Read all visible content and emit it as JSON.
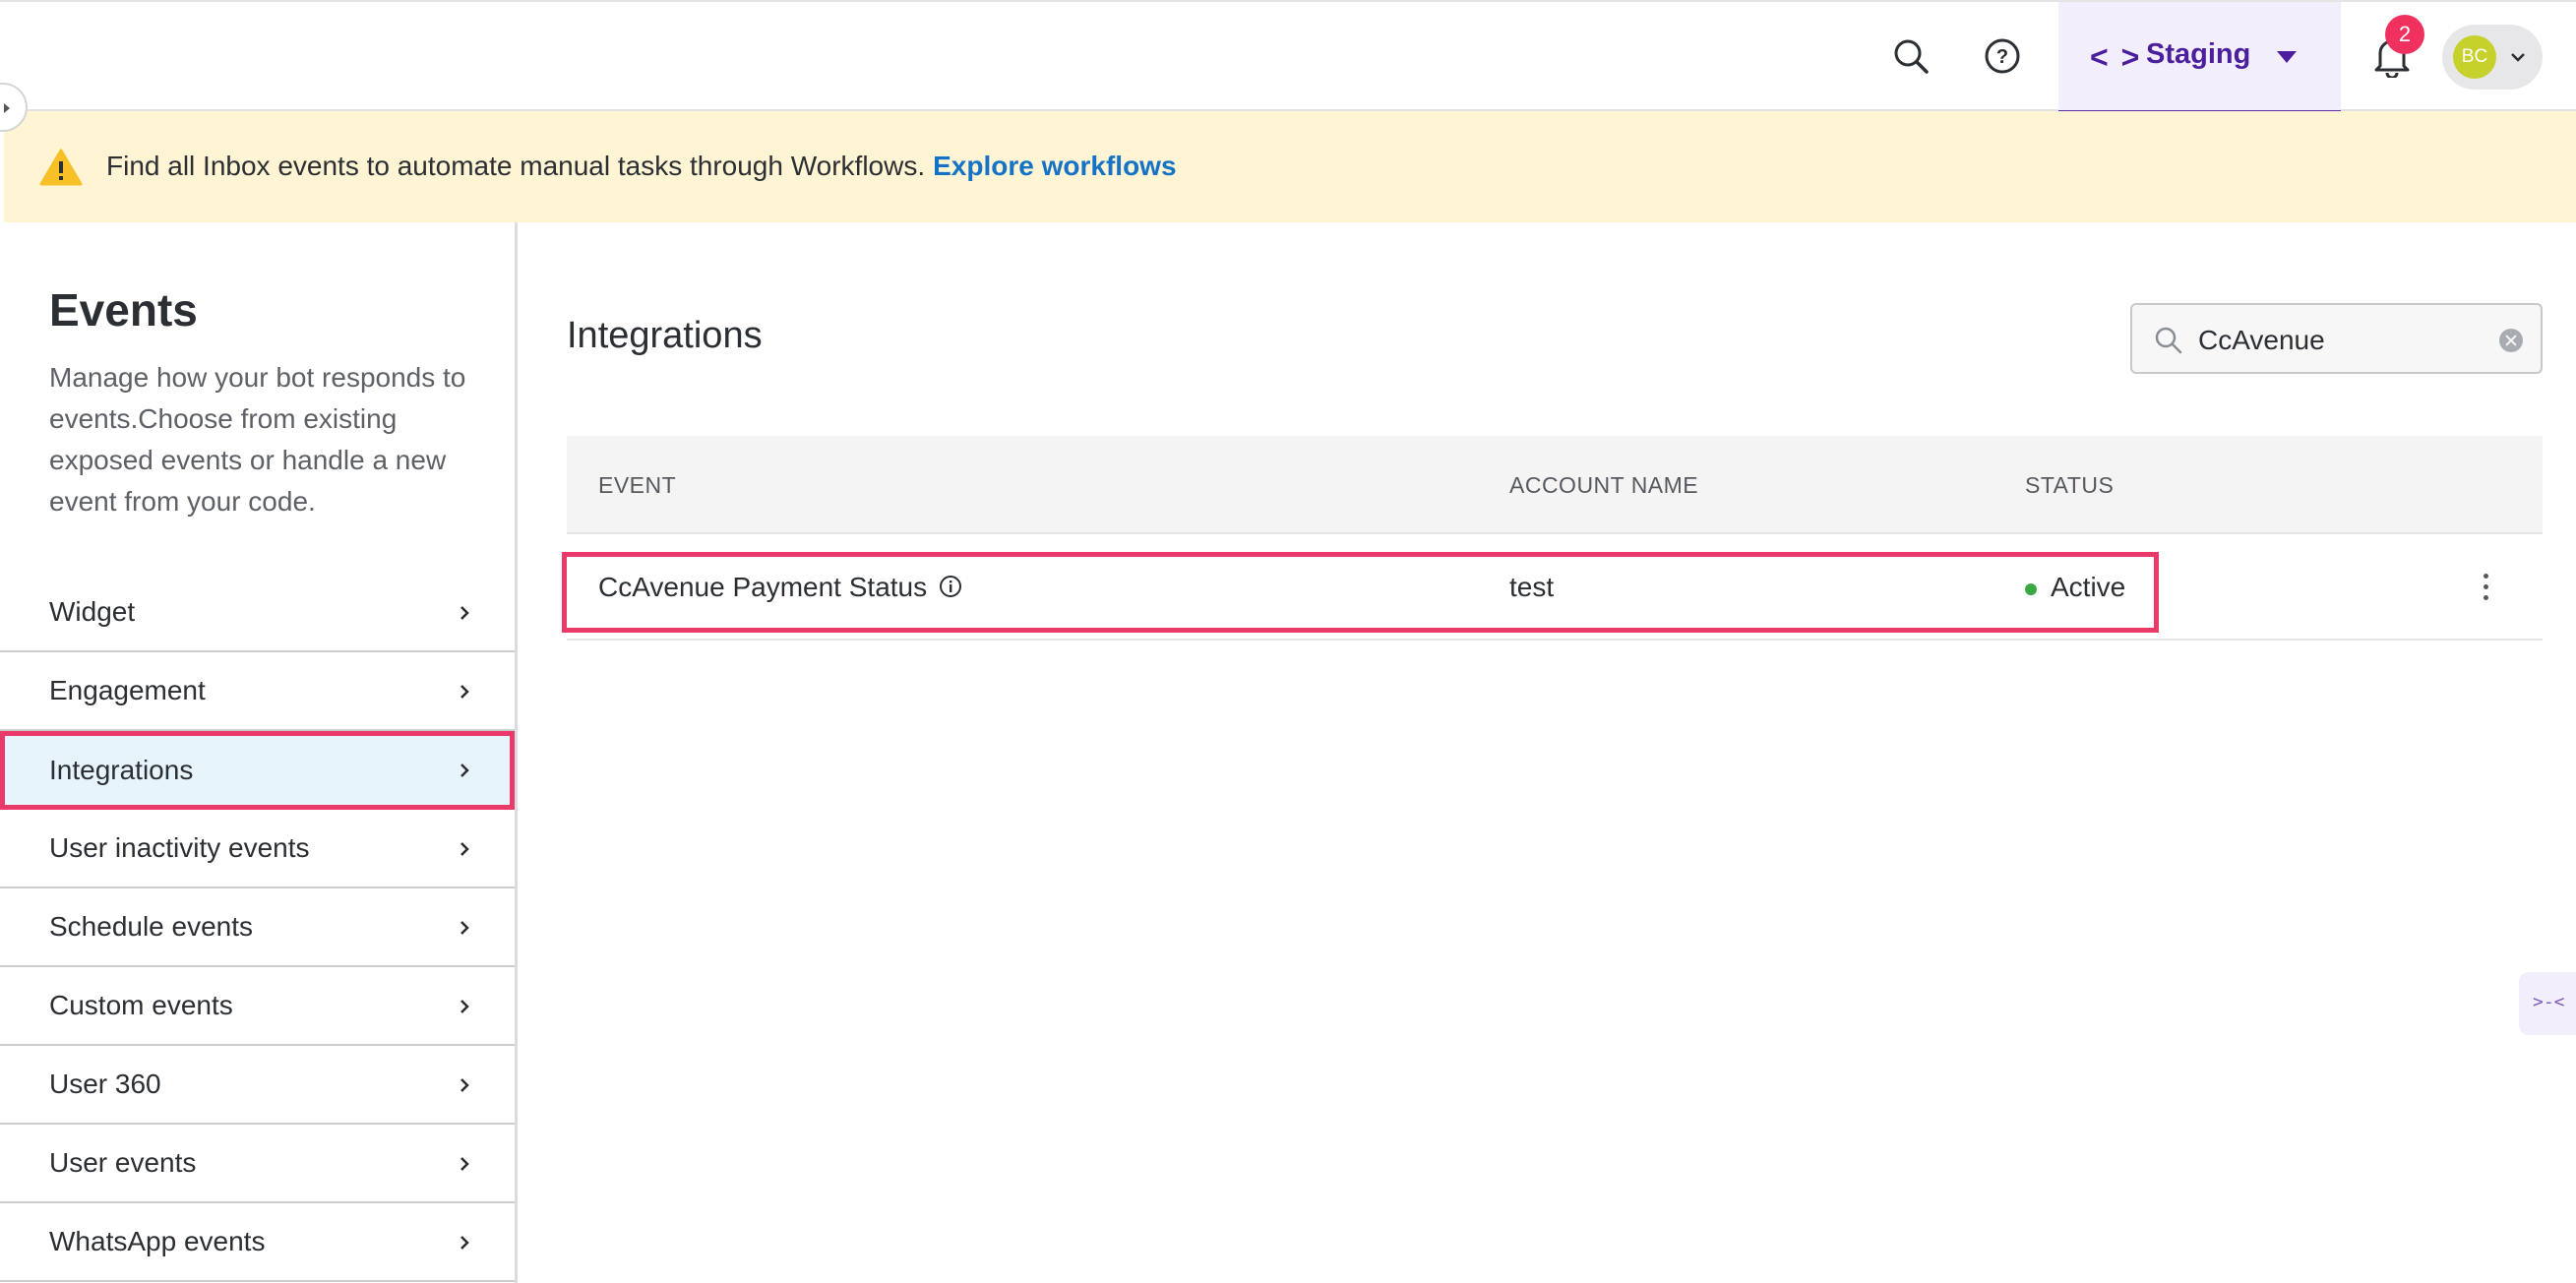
{
  "header": {
    "environment": {
      "code_symbol": "< >",
      "label": "Staging"
    },
    "notifications_count": "2",
    "user_initials": "BC"
  },
  "banner": {
    "text": "Find all Inbox events to automate manual tasks through Workflows.",
    "link": "Explore workflows"
  },
  "sidebar": {
    "title": "Events",
    "description": "Manage how your bot responds to events.Choose from existing exposed events or handle a new event from your code.",
    "items": [
      {
        "label": "Widget"
      },
      {
        "label": "Engagement"
      },
      {
        "label": "Integrations",
        "active": true
      },
      {
        "label": "User inactivity events"
      },
      {
        "label": "Schedule events"
      },
      {
        "label": "Custom events"
      },
      {
        "label": "User 360"
      },
      {
        "label": "User events"
      },
      {
        "label": "WhatsApp events"
      }
    ]
  },
  "main": {
    "title": "Integrations",
    "search": {
      "value": "CcAvenue"
    },
    "table": {
      "columns": [
        "EVENT",
        "ACCOUNT NAME",
        "STATUS"
      ],
      "rows": [
        {
          "event": "CcAvenue Payment Status",
          "account_name": "test",
          "status": "Active"
        }
      ]
    }
  },
  "colors": {
    "accent": "#5b2aa8",
    "highlight_border": "#ea3a6a",
    "banner_bg": "#fff4d4",
    "link": "#1473c7",
    "status_active": "#3aa845"
  }
}
